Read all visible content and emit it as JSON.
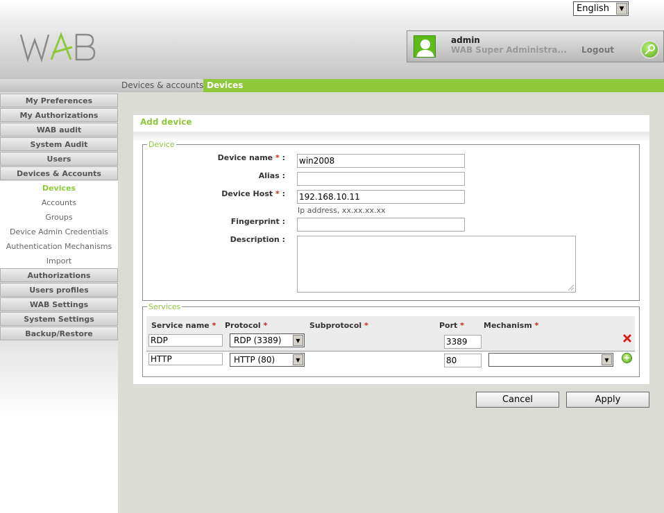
{
  "language": {
    "selected": "English"
  },
  "logo": {
    "text": "WAB",
    "accent": "#8fc83a",
    "gray": "#888888"
  },
  "user": {
    "name": "admin",
    "role": "WAB Super Administra...",
    "logout_label": "Logout"
  },
  "breadcrumb": {
    "parent": "Devices & accounts",
    "current": "Devices"
  },
  "sidebar": {
    "sections_top": [
      "My Preferences",
      "My Authorizations",
      "WAB audit",
      "System Audit",
      "Users",
      "Devices & Accounts"
    ],
    "subitems": [
      "Devices",
      "Accounts",
      "Groups",
      "Device Admin Credentials",
      "Authentication Mechanisms",
      "Import"
    ],
    "active_subitem": "Devices",
    "sections_bottom": [
      "Authorizations",
      "Users profiles",
      "WAB Settings",
      "System Settings",
      "Backup/Restore"
    ]
  },
  "form": {
    "title": "Add device",
    "device_legend": "Device",
    "fields": {
      "device_name": {
        "label": "Device name",
        "value": "win2008"
      },
      "alias": {
        "label": "Alias",
        "value": ""
      },
      "device_host": {
        "label": "Device Host",
        "value": "192.168.10.11",
        "hint": "Ip address, xx.xx.xx.xx"
      },
      "fingerprint": {
        "label": "Fingerprint",
        "value": ""
      },
      "description": {
        "label": "Description",
        "value": ""
      }
    },
    "required_mark": "*",
    "colon": ":",
    "services_legend": "Services",
    "columns": [
      "Service name",
      "Protocol",
      "Subprotocol",
      "Port",
      "Mechanism"
    ],
    "services": [
      {
        "name": "RDP",
        "protocol": "RDP (3389)",
        "port": "3389",
        "mechanism": "",
        "action": "delete-icon"
      },
      {
        "name": "HTTP",
        "protocol": "HTTP (80)",
        "port": "80",
        "mechanism": "",
        "action": "add-icon"
      }
    ]
  },
  "buttons": {
    "cancel": "Cancel",
    "apply": "Apply"
  },
  "colors": {
    "accent": "#8fc83a",
    "required": "#d2231c",
    "delete": "#d2231c"
  }
}
